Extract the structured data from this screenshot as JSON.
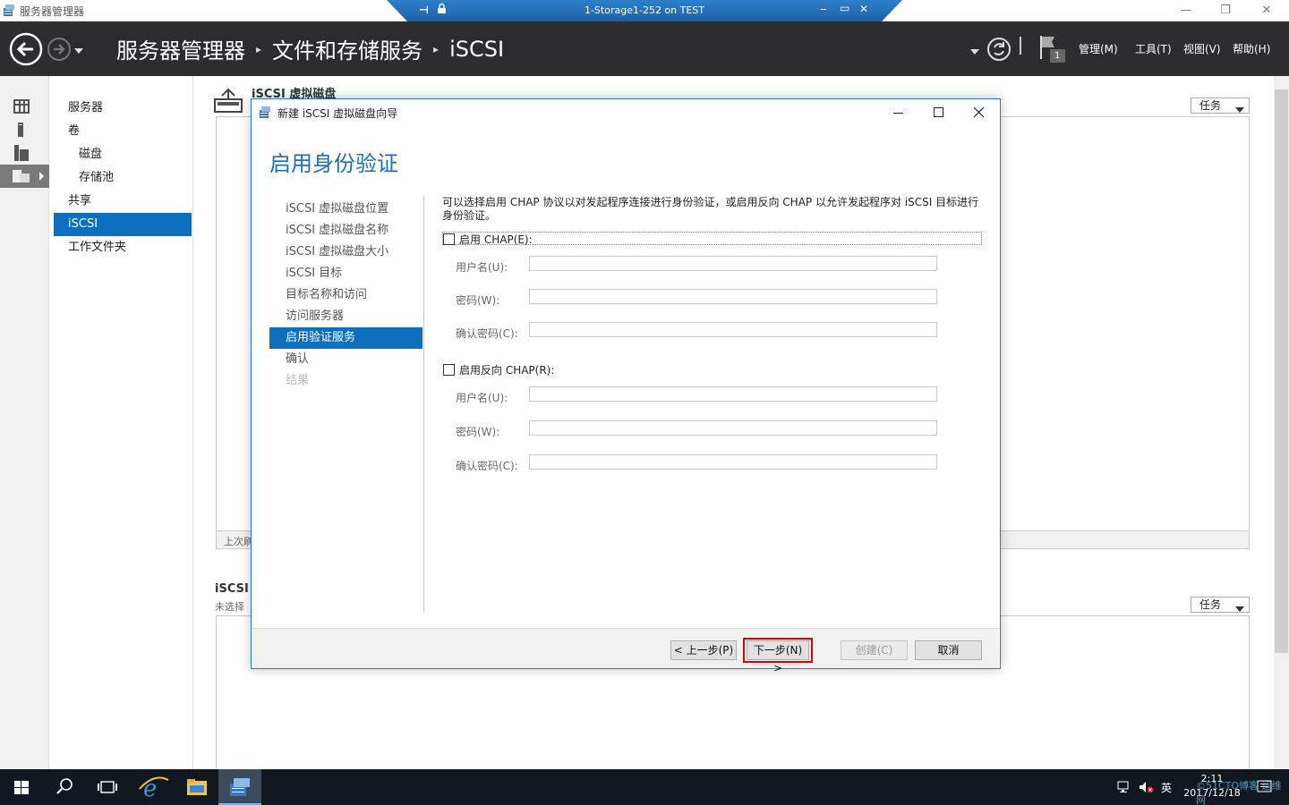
{
  "window": {
    "title": "服务器管理器",
    "minimize": "—",
    "restore": "❐",
    "close": "✕"
  },
  "remote_bar": {
    "title": "1-Storage1-252 on TEST",
    "pin": "⊣",
    "lock": "🔒",
    "min": "‒",
    "restore": "▭",
    "close": "✕"
  },
  "header": {
    "breadcrumb": [
      "服务器管理器",
      "文件和存储服务",
      "iSCSI"
    ],
    "separator": "▸",
    "menus": [
      "管理(M)",
      "工具(T)",
      "视图(V)",
      "帮助(H)"
    ],
    "flag_badge": "1"
  },
  "sidebar": {
    "items": [
      {
        "label": "服务器",
        "sub": false
      },
      {
        "label": "卷",
        "sub": false
      },
      {
        "label": "磁盘",
        "sub": true
      },
      {
        "label": "存储池",
        "sub": true
      },
      {
        "label": "共享",
        "sub": false
      },
      {
        "label": "iSCSI",
        "sub": false,
        "selected": true
      },
      {
        "label": "工作文件夹",
        "sub": false
      }
    ]
  },
  "main": {
    "panel1_title": "iSCSI 虚拟磁盘",
    "panel1_footer": "上次刷",
    "panel2_title": "iSCSI",
    "panel2_subtitle": "未选择",
    "task_label": "任务"
  },
  "dialog": {
    "title": "新建 iSCSI 虚拟磁盘向导",
    "heading": "启用身份验证",
    "steps": [
      {
        "label": "iSCSI 虚拟磁盘位置",
        "state": "normal"
      },
      {
        "label": "iSCSI 虚拟磁盘名称",
        "state": "normal"
      },
      {
        "label": "iSCSI 虚拟磁盘大小",
        "state": "normal"
      },
      {
        "label": "iSCSI 目标",
        "state": "normal"
      },
      {
        "label": "目标名称和访问",
        "state": "normal"
      },
      {
        "label": "访问服务器",
        "state": "normal"
      },
      {
        "label": "启用验证服务",
        "state": "selected"
      },
      {
        "label": "确认",
        "state": "normal"
      },
      {
        "label": "结果",
        "state": "disabled"
      }
    ],
    "description": "可以选择启用 CHAP 协议以对发起程序连接进行身份验证，或启用反向 CHAP 以允许发起程序对 iSCSI 目标进行身份验证。",
    "chap": {
      "label": "启用 CHAP(E):",
      "checked": false,
      "username_label": "用户名(U):",
      "password_label": "密码(W):",
      "confirm_label": "确认密码(C):"
    },
    "reverse_chap": {
      "label": "启用反向 CHAP(R):",
      "checked": false,
      "username_label": "用户名(U):",
      "password_label": "密码(W):",
      "confirm_label": "确认密码(C):"
    },
    "buttons": {
      "prev": "< 上一步(P)",
      "next": "下一步(N) >",
      "create": "创建(C)",
      "cancel": "取消"
    },
    "highlight_color": "#e00000"
  },
  "taskbar": {
    "ime": "英",
    "time": "2:11",
    "date": "2017/12/18",
    "watermark": "©51CTO博客 运维网"
  },
  "colors": {
    "accent": "#0e6fbf",
    "header_bg": "#2d2d30",
    "taskbar_bg": "#111820"
  }
}
